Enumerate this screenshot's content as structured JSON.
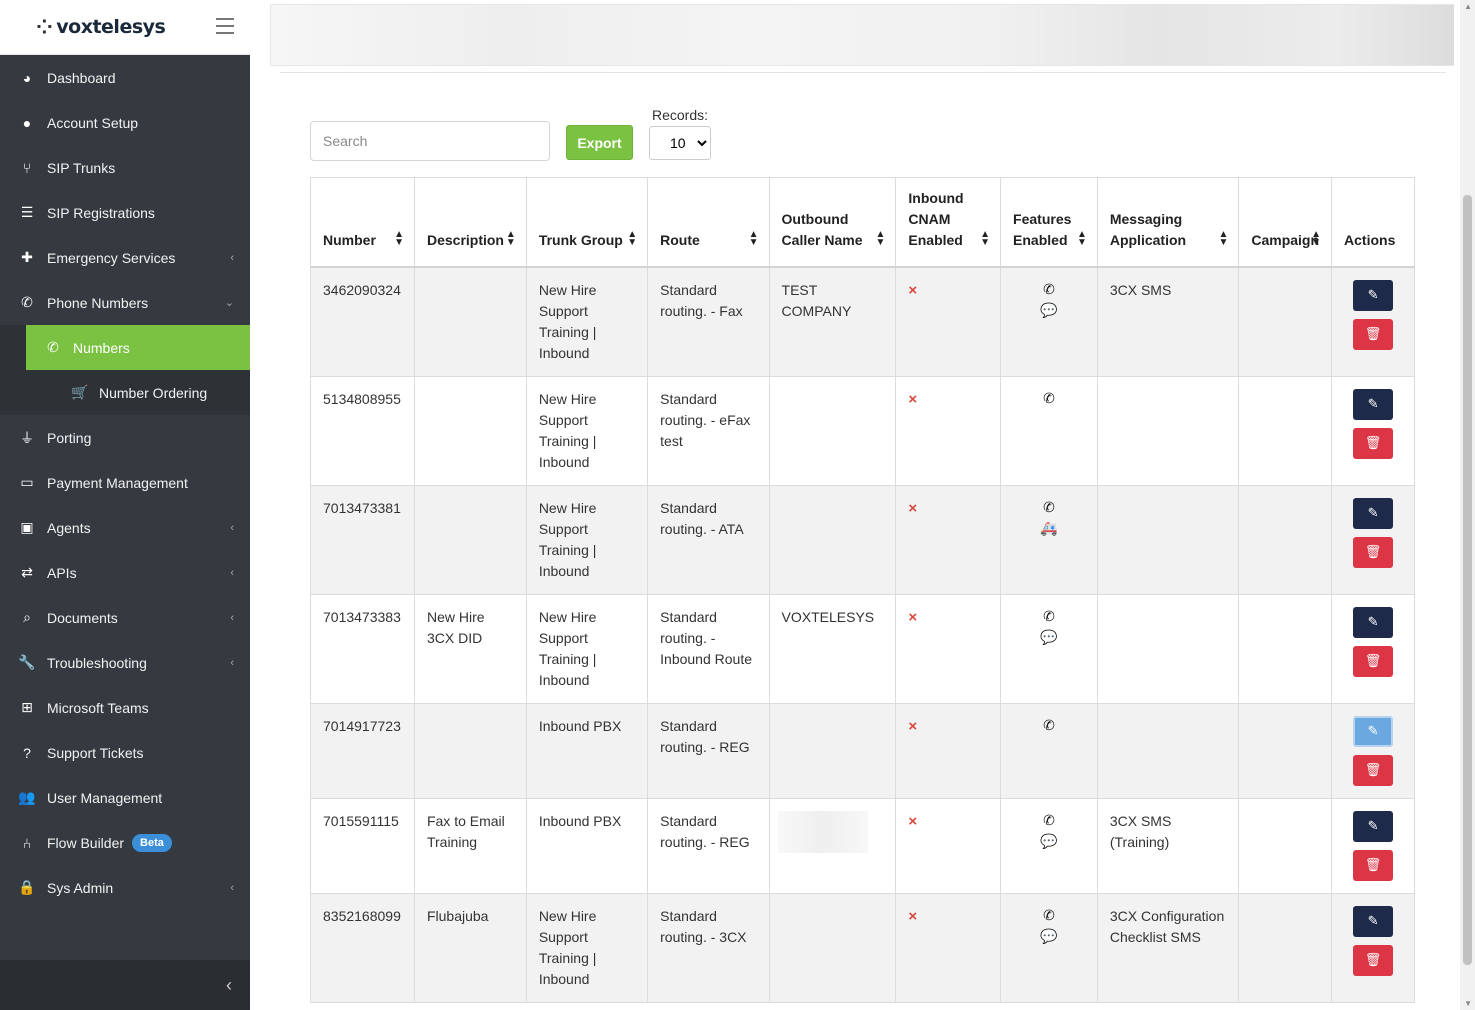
{
  "brand": {
    "name": "voxtelesys",
    "logo_mark": "⁘"
  },
  "sidebar": {
    "items": [
      {
        "label": "Dashboard",
        "icon": "dashboard-icon",
        "glyph": "◕",
        "chevron": ""
      },
      {
        "label": "Account Setup",
        "icon": "user-circle-icon",
        "glyph": "●",
        "chevron": ""
      },
      {
        "label": "SIP Trunks",
        "icon": "code-branch-icon",
        "glyph": "⑂",
        "chevron": ""
      },
      {
        "label": "SIP Registrations",
        "icon": "list-icon",
        "glyph": "☰",
        "chevron": ""
      },
      {
        "label": "Emergency Services",
        "icon": "medkit-icon",
        "glyph": "✚",
        "chevron": "‹"
      },
      {
        "label": "Phone Numbers",
        "icon": "phone-icon",
        "glyph": "✆",
        "chevron": "⌄"
      }
    ],
    "sub_items": [
      {
        "label": "Numbers",
        "icon": "phone-icon",
        "glyph": "✆"
      },
      {
        "label": "Number Ordering",
        "icon": "cart-icon",
        "glyph": "🛒"
      }
    ],
    "items_after": [
      {
        "label": "Porting",
        "icon": "plug-icon",
        "glyph": "⏚",
        "chevron": ""
      },
      {
        "label": "Payment Management",
        "icon": "credit-card-icon",
        "glyph": "▭",
        "chevron": ""
      },
      {
        "label": "Agents",
        "icon": "briefcase-icon",
        "glyph": "▣",
        "chevron": "‹"
      },
      {
        "label": "APIs",
        "icon": "exchange-icon",
        "glyph": "⇄",
        "chevron": "‹"
      },
      {
        "label": "Documents",
        "icon": "search-icon",
        "glyph": "⌕",
        "chevron": "‹"
      },
      {
        "label": "Troubleshooting",
        "icon": "wrench-icon",
        "glyph": "🔧",
        "chevron": "‹"
      },
      {
        "label": "Microsoft Teams",
        "icon": "windows-icon",
        "glyph": "⊞",
        "chevron": ""
      },
      {
        "label": "Support Tickets",
        "icon": "question-icon",
        "glyph": "?",
        "chevron": ""
      },
      {
        "label": "User Management",
        "icon": "users-icon",
        "glyph": "👥",
        "chevron": ""
      },
      {
        "label": "Flow Builder",
        "icon": "sitemap-icon",
        "glyph": "⑃",
        "chevron": "",
        "badge": "Beta"
      },
      {
        "label": "Sys Admin",
        "icon": "lock-icon",
        "glyph": "🔒",
        "chevron": "‹"
      }
    ],
    "collapse_glyph": "‹"
  },
  "toolbar": {
    "search_placeholder": "Search",
    "export_label": "Export",
    "records_label": "Records:",
    "records_value": "10"
  },
  "table": {
    "headers": [
      "Number",
      "Description",
      "Trunk Group",
      "Route",
      "Outbound Caller Name",
      "Inbound CNAM Enabled",
      "Features Enabled",
      "Messaging Application",
      "Campaign",
      "Actions"
    ],
    "rows": [
      {
        "number": "3462090324",
        "description": "",
        "trunk_group": "New Hire Support Training | Inbound",
        "route": "Standard routing. - Fax",
        "caller_name": "TEST COMPANY",
        "cnam": "×",
        "features": [
          "phone",
          "sms"
        ],
        "messaging": "3CX SMS",
        "campaign": ""
      },
      {
        "number": "5134808955",
        "description": "",
        "trunk_group": "New Hire Support Training | Inbound",
        "route": "Standard routing. - eFax test",
        "caller_name": "",
        "cnam": "×",
        "features": [
          "phone"
        ],
        "messaging": "",
        "campaign": ""
      },
      {
        "number": "7013473381",
        "description": "",
        "trunk_group": "New Hire Support Training | Inbound",
        "route": "Standard routing. - ATA",
        "caller_name": "",
        "cnam": "×",
        "features": [
          "phone",
          "ambulance"
        ],
        "messaging": "",
        "campaign": ""
      },
      {
        "number": "7013473383",
        "description": "New Hire 3CX DID",
        "trunk_group": "New Hire Support Training | Inbound",
        "route": "Standard routing. - Inbound Route",
        "caller_name": "VOXTELESYS",
        "cnam": "×",
        "features": [
          "phone",
          "sms"
        ],
        "messaging": "",
        "campaign": ""
      },
      {
        "number": "7014917723",
        "description": "",
        "trunk_group": "Inbound PBX",
        "route": "Standard routing. - REG",
        "caller_name": "",
        "cnam": "×",
        "features": [
          "phone"
        ],
        "messaging": "",
        "campaign": ""
      },
      {
        "number": "7015591115",
        "description": "Fax to Email Training",
        "trunk_group": "Inbound PBX",
        "route": "Standard routing. - REG",
        "caller_name": "",
        "cnam": "×",
        "features": [
          "phone",
          "sms"
        ],
        "messaging": "3CX SMS (Training)",
        "campaign": ""
      },
      {
        "number": "8352168099",
        "description": "Flubajuba",
        "trunk_group": "New Hire Support Training | Inbound",
        "route": "Standard routing. - 3CX",
        "caller_name": "",
        "cnam": "×",
        "features": [
          "phone",
          "sms"
        ],
        "messaging": "3CX Configuration Checklist SMS",
        "campaign": ""
      }
    ],
    "feature_glyphs": {
      "phone": "✆",
      "sms": "💬",
      "ambulance": "🚑"
    },
    "edit_glyph": "✎",
    "delete_glyph": "🗑"
  },
  "colors": {
    "accent": "#7cc242",
    "sidebar": "#343a40",
    "edit": "#1e2a4a",
    "delete": "#dc3545",
    "beta": "#3a8fd8"
  }
}
